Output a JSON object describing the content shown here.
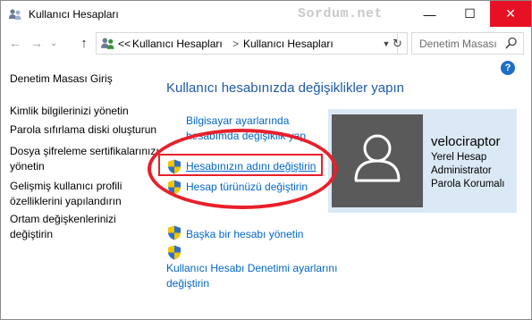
{
  "window": {
    "title": "Kullanıcı Hesapları",
    "watermark": "Sordum.net",
    "minimize": "—",
    "maximize": "☐",
    "close": "✕"
  },
  "navigation": {
    "back": "←",
    "forward": "→",
    "recent": "⌄",
    "up": "↑",
    "breadcrumb": [
      "<<",
      "Kullanıcı Hesapları",
      ">",
      "Kullanıcı Hesapları"
    ],
    "refresh": "↻",
    "search_placeholder": "Denetim Masası"
  },
  "help": "?",
  "sidebar": {
    "home": "Denetim Masası Giriş",
    "items": [
      {
        "lines": [
          "Kimlik bilgilerinizi yönetin"
        ]
      },
      {
        "lines": [
          "Parola sıfırlama diski oluşturun"
        ]
      },
      {
        "lines": [
          "Dosya şifreleme sertifikalarınızı",
          "yönetin"
        ]
      },
      {
        "lines": [
          "Gelişmiş kullanıcı profili",
          "özelliklerini yapılandırın"
        ]
      },
      {
        "lines": [
          "Ortam değişkenlerinizi",
          "değiştirin"
        ]
      }
    ]
  },
  "main": {
    "title": "Kullanıcı hesabınızda değişiklikler yapın",
    "tasks": {
      "pc_settings": [
        "Bilgisayar ayarlarında",
        "hesabımda değişiklik yap"
      ],
      "change_name": "Hesabınızın adını değiştirin",
      "change_type": "Hesap türünüzü değiştirin",
      "manage_other": "Başka bir hesabı yönetin",
      "uac_settings": [
        "Kullanıcı Hesabı Denetimi ayarlarını",
        "değiştirin"
      ]
    }
  },
  "account": {
    "name": "velociraptor",
    "details": [
      "Yerel Hesap",
      "Administrator",
      "Parola Korumalı"
    ]
  },
  "colors": {
    "link": "#0066cc",
    "title_blue": "#1e5aa8",
    "annotation_red": "#e8202a",
    "card_bg": "#dbe9f6",
    "avatar_bg": "#5a5a5a",
    "close_red": "#e81123"
  },
  "icons": [
    "users-icon",
    "search-icon",
    "shield-icon",
    "user-avatar-icon",
    "help-icon"
  ]
}
